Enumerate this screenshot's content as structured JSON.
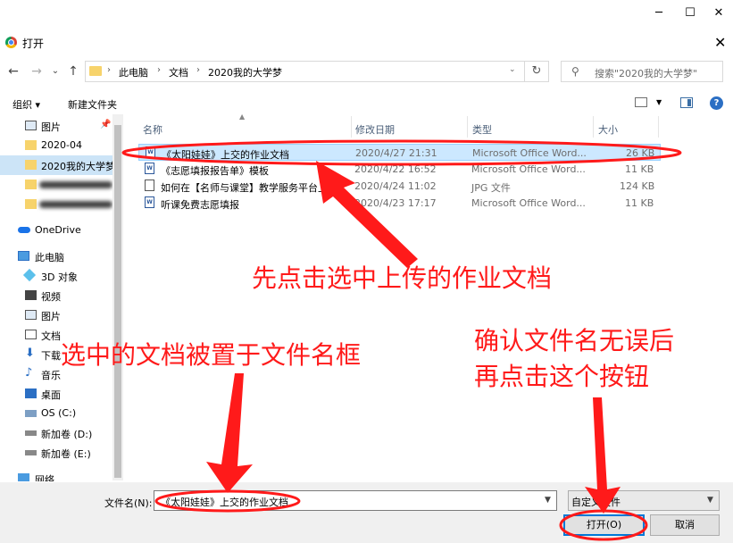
{
  "window": {
    "minimize": "─",
    "maximize": "☐",
    "close": "✕"
  },
  "dialog": {
    "title": "打开",
    "close": "✕"
  },
  "nav": {
    "back": "←",
    "forward": "→",
    "recent": "⌄",
    "up": "↑",
    "breadcrumbs": [
      "此电脑",
      "文档",
      "2020我的大学梦"
    ],
    "refresh": "↻",
    "search_placeholder": "搜索\"2020我的大学梦\""
  },
  "toolbar": {
    "organize": "组织 ▾",
    "new_folder": "新建文件夹",
    "help": "?"
  },
  "sidebar": {
    "items": [
      {
        "label": "图片",
        "icon": "pictures-icon",
        "pinned": true
      },
      {
        "label": "2020-04",
        "icon": "folder-icon"
      },
      {
        "label": "2020我的大学梦",
        "icon": "folder-icon",
        "selected": true
      },
      {
        "label": "",
        "icon": "folder-icon",
        "redacted": true
      },
      {
        "label": "",
        "icon": "folder-icon",
        "redacted": true
      },
      {
        "label": "OneDrive",
        "icon": "cloud-icon"
      },
      {
        "label": "此电脑",
        "icon": "computer-icon"
      },
      {
        "label": "3D 对象",
        "icon": "3d-objects-icon"
      },
      {
        "label": "视频",
        "icon": "video-icon"
      },
      {
        "label": "图片",
        "icon": "pictures-icon"
      },
      {
        "label": "文档",
        "icon": "documents-icon"
      },
      {
        "label": "下载",
        "icon": "download-icon"
      },
      {
        "label": "音乐",
        "icon": "music-icon"
      },
      {
        "label": "桌面",
        "icon": "desktop-icon"
      },
      {
        "label": "OS (C:)",
        "icon": "drive-icon"
      },
      {
        "label": "新加卷 (D:)",
        "icon": "drive-icon"
      },
      {
        "label": "新加卷 (E:)",
        "icon": "drive-icon"
      },
      {
        "label": "网络",
        "icon": "network-icon"
      }
    ]
  },
  "columns": {
    "name": "名称",
    "date": "修改日期",
    "type": "类型",
    "size": "大小"
  },
  "files": [
    {
      "name": "《太阳娃娃》上交的作业文档",
      "date": "2020/4/27 21:31",
      "type": "Microsoft Office Word...",
      "size": "26 KB",
      "icon": "word-icon",
      "selected": true
    },
    {
      "name": "《志愿填报报告单》模板",
      "date": "2020/4/22 16:52",
      "type": "Microsoft Office Word...",
      "size": "11 KB",
      "icon": "word-icon"
    },
    {
      "name": "如何在【名师与课堂】教学服务平台上...",
      "date": "2020/4/24 11:02",
      "type": "JPG 文件",
      "size": "124 KB",
      "icon": "jpg-icon"
    },
    {
      "name": "听课免费志愿填报",
      "date": "2020/4/23 17:17",
      "type": "Microsoft Office Word...",
      "size": "11 KB",
      "icon": "word-icon"
    }
  ],
  "bottom": {
    "filename_label": "文件名(N):",
    "filename_value": "《太阳娃娃》上交的作业文档",
    "filetype_value": "自定义文件",
    "open_button": "打开(O)",
    "cancel_button": "取消"
  },
  "annotations": {
    "a1": "先点击选中上传的作业文档",
    "a2": "选中的文档被置于文件名框",
    "a3_line1": "确认文件名无误后",
    "a3_line2": "再点击这个按钮"
  },
  "colors": {
    "annotation": "#ff1a1a",
    "selection": "#cce8ff",
    "accent": "#0078d7"
  }
}
